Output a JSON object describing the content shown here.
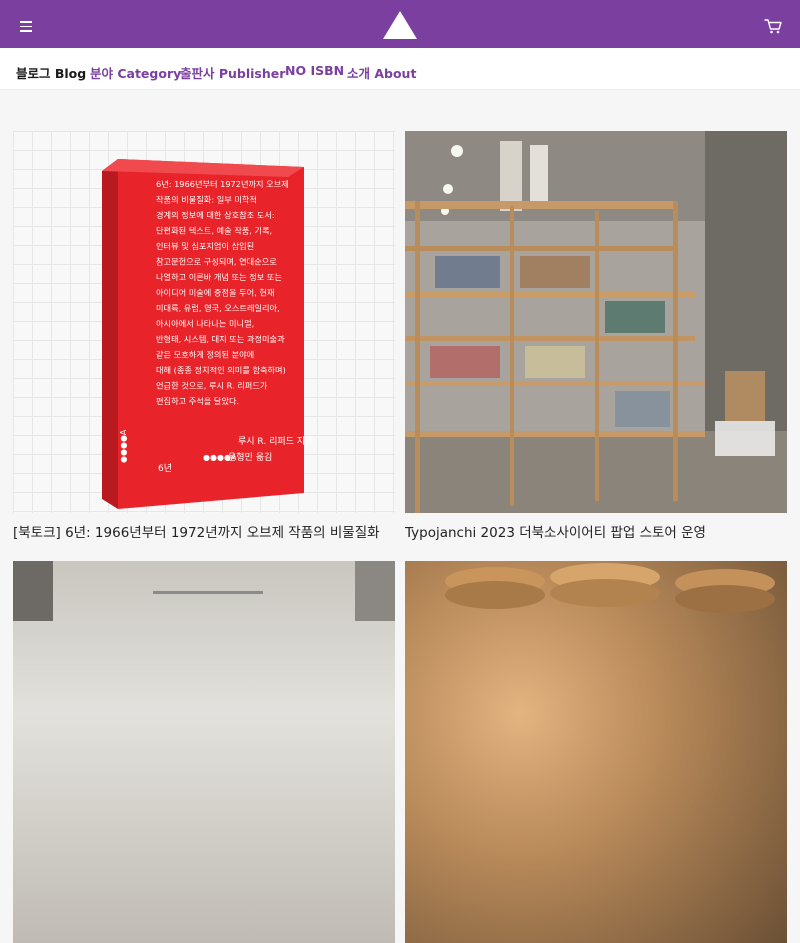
{
  "header": {
    "menu_icon": "hamburger-menu-icon",
    "logo_icon": "triangle-logo-icon",
    "cart_icon": "shopping-cart-icon",
    "background_color": "#7b3fa0"
  },
  "nav": {
    "items": [
      {
        "label": "블로그 Blog",
        "active": true
      },
      {
        "label": "분야 Category",
        "active": false
      },
      {
        "label": "출판사 Publisher",
        "active": false
      },
      {
        "label": "NO ISBN",
        "active": false
      },
      {
        "label": "소개 About",
        "active": false
      }
    ]
  },
  "posts": [
    {
      "title": "[북토크] 6년: 1966년부터 1972년까지 오브제 작품의 비물질화",
      "image": "red-book-box-image",
      "book": {
        "cover_lines": [
          "6년: 1966년부터 1972년까지 오브제",
          "작품의 비물질화: 일부 미학적",
          "경계의 정보에 대한 상호참조 도서:",
          "단편화된 텍스트, 예술 작품, 기록,",
          "인터뷰 및 심포지엄이 삽입된",
          "참고문헌으로 구성되며, 연대순으로",
          "나열하고 이른바 개념 또는 정보 또는",
          "아이디어 미술에 중점을 두어, 현재",
          "미대륙, 유럽, 영국, 오스트레일리아,",
          "아시아에서 나타나는 미니멀,",
          "반형태, 시스템, 대지 또는 과정미술과",
          "같은 모호하게 정의된 분야에",
          "대해 (종종 정치적인 의미를 함축하며)",
          "언급한 것으로, 루시 R. 리퍼드가",
          "편집하고 주석을 달았다."
        ],
        "author": "루시 R. 리퍼드 지음",
        "translator": "윤형민 옮김",
        "title_short": "6년",
        "publisher_mark": "●●●●A",
        "color": "#e8242a"
      }
    },
    {
      "title": "Typojanchi 2023 더북소사이어티 팝업 스토어 운영",
      "image": "bookshelf-popup-store-image"
    },
    {
      "title": "",
      "image": "gallery-ceiling-image"
    },
    {
      "title": "",
      "image": "coins-image"
    }
  ]
}
